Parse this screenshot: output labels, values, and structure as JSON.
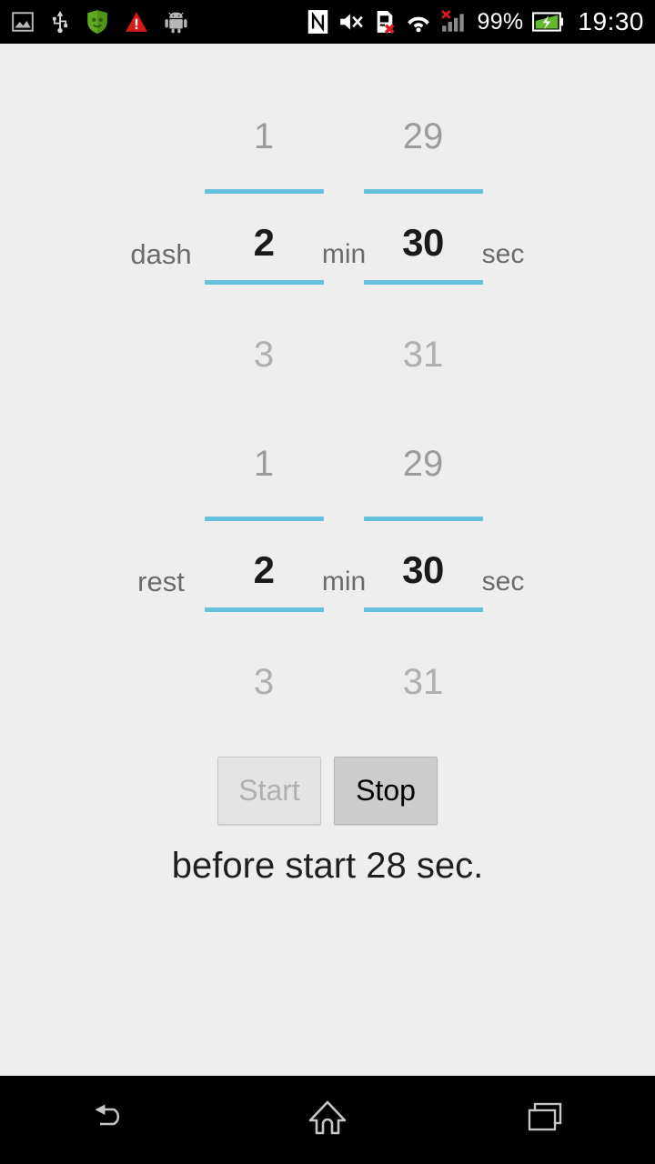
{
  "status_bar": {
    "left_icons": [
      {
        "name": "image-icon",
        "label": "screenshot"
      },
      {
        "name": "usb-icon",
        "label": "usb"
      },
      {
        "name": "shield-icon",
        "label": "antivirus"
      },
      {
        "name": "warning-icon",
        "label": "warning"
      },
      {
        "name": "android-icon",
        "label": "android"
      }
    ],
    "right_icons": [
      {
        "name": "nfc-icon",
        "label": "nfc"
      },
      {
        "name": "mute-icon",
        "label": "sound-off"
      },
      {
        "name": "sim-error-icon",
        "label": "no-sim"
      },
      {
        "name": "wifi-icon",
        "label": "wifi"
      },
      {
        "name": "cellular-signal-off-icon",
        "label": "no-signal"
      }
    ],
    "battery_percent": "99%",
    "clock": "19:30"
  },
  "pickers": [
    {
      "id": "dash",
      "label": "dash",
      "minutes": {
        "above": "1",
        "current": "2",
        "below": "3",
        "unit": "min"
      },
      "seconds": {
        "above": "29",
        "current": "30",
        "below": "31",
        "unit": "sec"
      }
    },
    {
      "id": "rest",
      "label": "rest",
      "minutes": {
        "above": "1",
        "current": "2",
        "below": "3",
        "unit": "min"
      },
      "seconds": {
        "above": "29",
        "current": "30",
        "below": "31",
        "unit": "sec"
      }
    }
  ],
  "buttons": {
    "start_label": "Start",
    "stop_label": "Stop"
  },
  "status_text": "before start 28 sec.",
  "nav_bar": {
    "back": "back-icon",
    "home": "home-icon",
    "recents": "recents-icon"
  },
  "colors": {
    "divider_blue": "#66c0dd",
    "app_background": "#eeeeee",
    "system_bar": "#000000"
  }
}
